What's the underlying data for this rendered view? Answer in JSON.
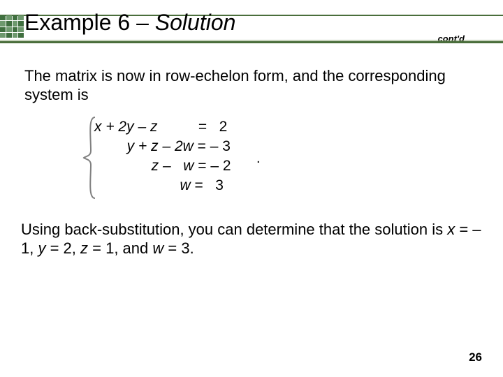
{
  "header": {
    "title_prefix": "Example 6",
    "title_dash": " – ",
    "title_suffix": "Solution",
    "contd": "cont'd"
  },
  "body": {
    "p1": "The matrix is now in row-echelon form, and the corresponding system is",
    "eq": {
      "r1_lhs": "x + 2y – z          ",
      "r1_eq": "=  ",
      "r1_rhs": " 2",
      "r2_lhs": "        y + z – 2w ",
      "r2_eq": "= ",
      "r2_rhs": "– 3",
      "r3_lhs": "              z –   w ",
      "r3_eq": "= ",
      "r3_rhs": "– 2",
      "r4_lhs": "                     w ",
      "r4_eq": "=  ",
      "r4_rhs": " 3",
      "period": "."
    },
    "p2_a": "Using back-substitution, you can determine that the solution is ",
    "p2_x": "x",
    "p2_b": " = – 1, ",
    "p2_y": "y",
    "p2_c": " = 2, ",
    "p2_z": "z",
    "p2_d": " = 1, and ",
    "p2_w": "w",
    "p2_e": " = 3."
  },
  "page": {
    "num": "26"
  }
}
